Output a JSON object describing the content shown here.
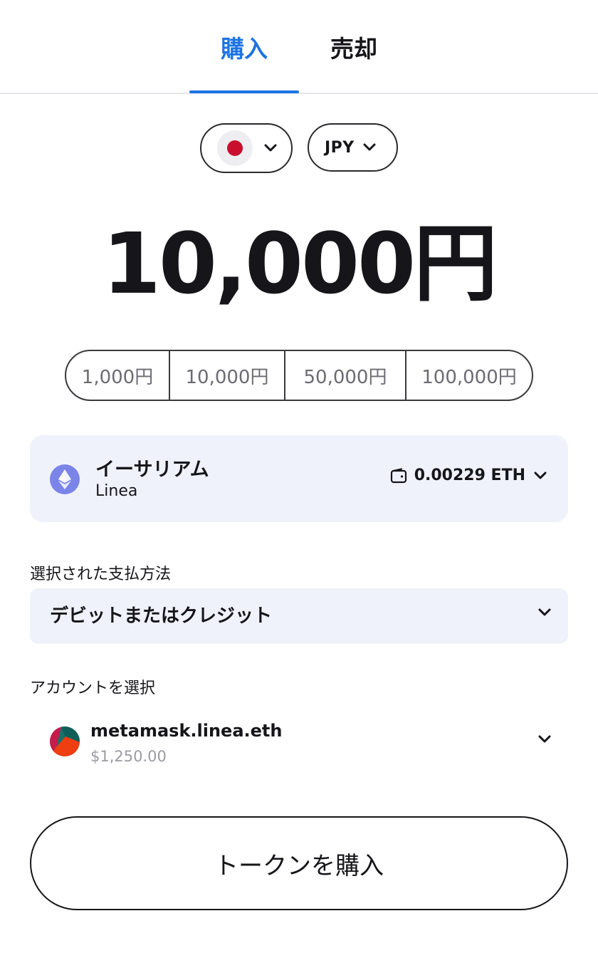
{
  "tabs": {
    "buy_label": "購入",
    "sell_label": "売却",
    "active": "buy"
  },
  "region": {
    "flag_icon": "japan-flag-icon",
    "flag_color": "#c8102e"
  },
  "currency": {
    "code": "JPY"
  },
  "amount": {
    "display": "10,000円"
  },
  "quick_amounts": [
    "1,000円",
    "10,000円",
    "50,000円",
    "100,000円"
  ],
  "token": {
    "name": "イーサリアム",
    "network": "Linea",
    "balance": "0.00229 ETH",
    "icon": "ethereum-icon"
  },
  "payment": {
    "label": "選択された支払方法",
    "selected": "デビットまたはクレジット"
  },
  "account": {
    "label": "アカウントを選択",
    "name": "metamask.linea.eth",
    "balance": "$1,250.00"
  },
  "cta": {
    "label": "トークンを購入"
  },
  "colors": {
    "accent": "#1d74e3",
    "card_bg": "#eff2fb",
    "muted_text": "#9b9ba3",
    "eth_icon_bg": "#7b84e8"
  }
}
